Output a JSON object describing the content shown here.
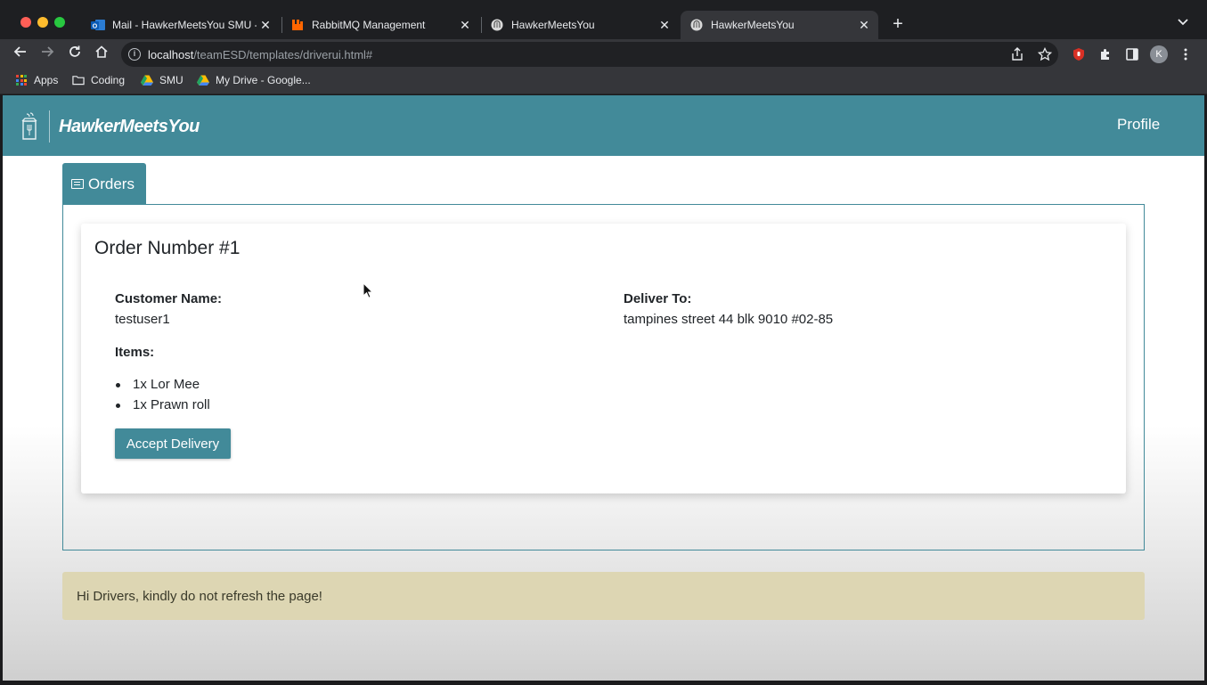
{
  "browser": {
    "tabs": [
      {
        "title": "Mail - HawkerMeetsYou SMU -",
        "icon": "outlook-mail-icon",
        "active": false
      },
      {
        "title": "RabbitMQ Management",
        "icon": "rabbitmq-icon",
        "active": false
      },
      {
        "title": "HawkerMeetsYou",
        "icon": "hawker-favicon-icon",
        "active": false
      },
      {
        "title": "HawkerMeetsYou",
        "icon": "hawker-favicon-icon",
        "active": true
      }
    ],
    "url_host": "localhost",
    "url_path": "/teamESD/templates/driverui.html#",
    "avatar_initial": "K",
    "bookmarks": [
      {
        "label": "Apps",
        "icon": "apps-grid-icon"
      },
      {
        "label": "Coding",
        "icon": "folder-icon"
      },
      {
        "label": "SMU",
        "icon": "google-drive-icon"
      },
      {
        "label": "My Drive - Google...",
        "icon": "google-drive-icon"
      }
    ]
  },
  "navbar": {
    "brand": "HawkerMeetsYou",
    "profile": "Profile"
  },
  "orders_tab": {
    "label": "Orders"
  },
  "order": {
    "title": "Order Number #1",
    "customer_label": "Customer Name:",
    "customer_value": "testuser1",
    "deliver_label": "Deliver To:",
    "deliver_value": "tampines street 44 blk 9010 #02-85",
    "items_label": "Items:",
    "items": [
      "1x Lor Mee",
      "1x Prawn roll"
    ],
    "accept_button": "Accept Delivery"
  },
  "alert": {
    "text": "Hi Drivers, kindly do not refresh the page!"
  },
  "colors": {
    "brand_teal": "#428a99",
    "alert_bg": "#ddd6b3"
  }
}
